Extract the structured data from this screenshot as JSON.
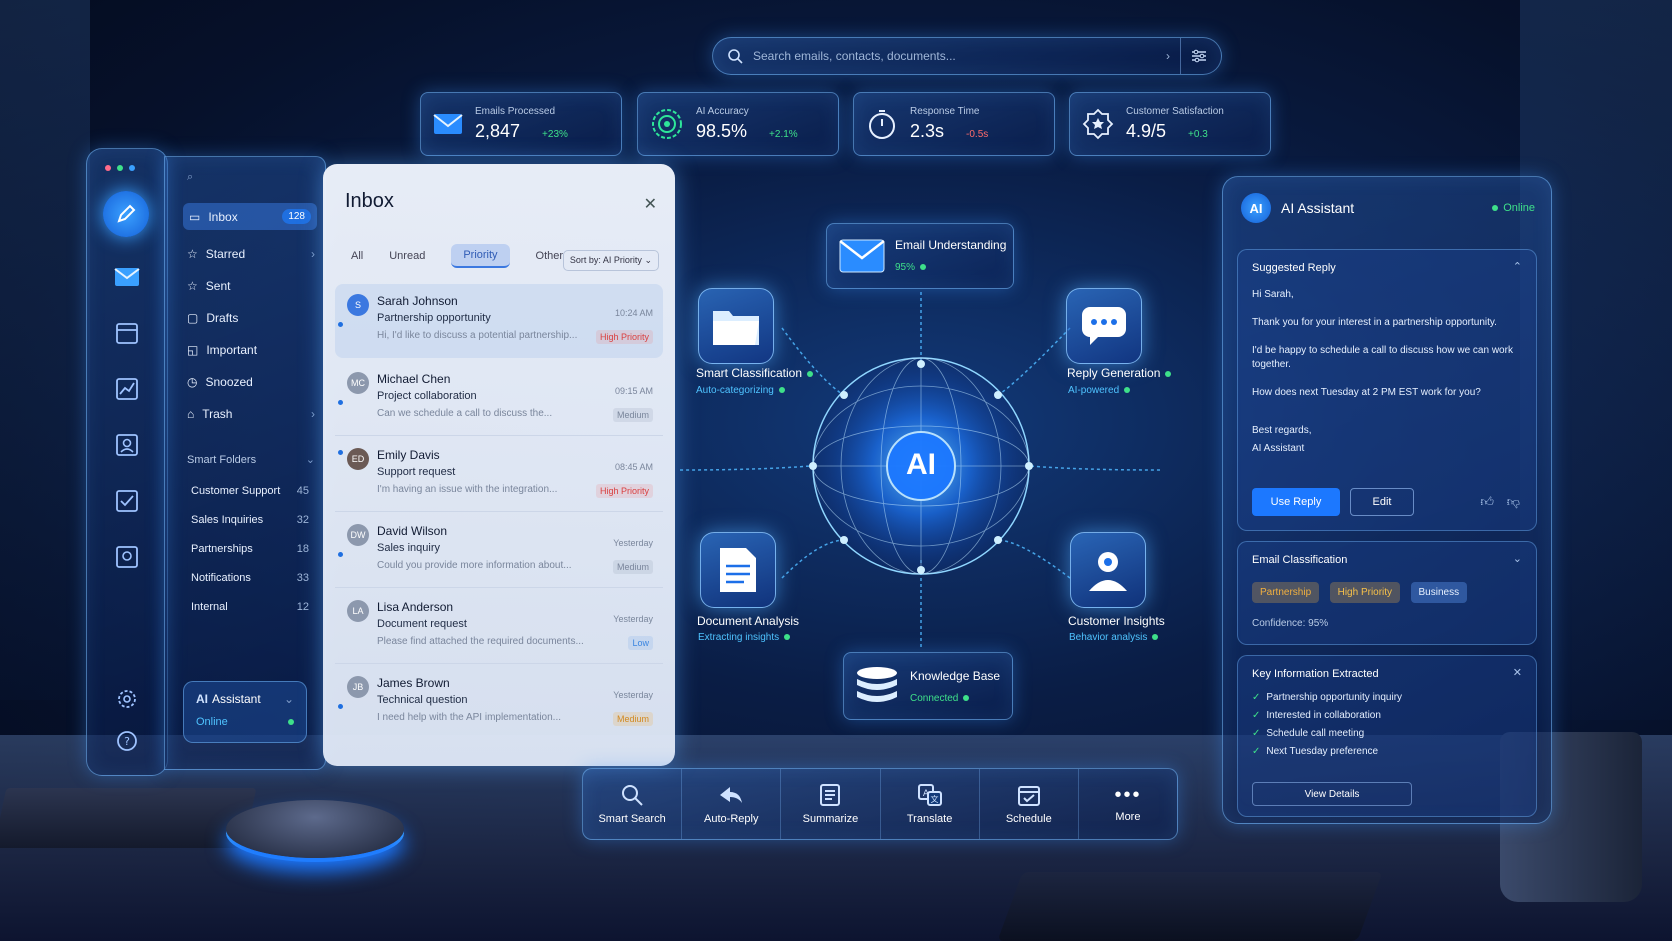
{
  "search": {
    "placeholder": "Search emails, contacts, documents..."
  },
  "stats": [
    {
      "label": "Emails Processed",
      "value": "2,847",
      "delta": "+23%",
      "icon": "envelope-icon"
    },
    {
      "label": "AI Accuracy",
      "value": "98.5%",
      "delta": "+2.1%",
      "icon": "target-icon"
    },
    {
      "label": "Response Time",
      "value": "2.3s",
      "delta": "-0.5s",
      "icon": "stopwatch-icon"
    },
    {
      "label": "Customer Satisfaction",
      "value": "4.9/5",
      "delta": "+0.3",
      "icon": "star-badge-icon"
    }
  ],
  "nav": {
    "items": [
      {
        "label": "Inbox",
        "count": "128"
      },
      {
        "label": "Starred"
      },
      {
        "label": "Sent"
      },
      {
        "label": "Drafts"
      },
      {
        "label": "Important"
      },
      {
        "label": "Snoozed"
      },
      {
        "label": "Trash"
      }
    ],
    "smart_folders_label": "Smart Folders",
    "folders": [
      {
        "label": "Customer Support",
        "count": "45"
      },
      {
        "label": "Sales Inquiries",
        "count": "32"
      },
      {
        "label": "Partnerships",
        "count": "18"
      },
      {
        "label": "Notifications",
        "count": "33"
      },
      {
        "label": "Internal",
        "count": "12"
      }
    ],
    "assistant": {
      "title": "Assistant",
      "status": "Online"
    }
  },
  "inbox": {
    "title": "Inbox",
    "tabs": [
      "All",
      "Unread",
      "Priority",
      "Other"
    ],
    "sort": "Sort by: AI Priority",
    "emails": [
      {
        "initials": "S",
        "name": "Sarah Johnson",
        "subject": "Partnership opportunity",
        "preview": "Hi, I'd like to discuss a potential partnership...",
        "time": "10:24 AM",
        "tag": "High Priority"
      },
      {
        "initials": "MC",
        "name": "Michael Chen",
        "subject": "Project collaboration",
        "preview": "Can we schedule a call to discuss the...",
        "time": "09:15 AM",
        "tag": "Medium"
      },
      {
        "initials": "ED",
        "name": "Emily Davis",
        "subject": "Support request",
        "preview": "I'm having an issue with the integration...",
        "time": "08:45 AM",
        "tag": "High Priority"
      },
      {
        "initials": "DW",
        "name": "David Wilson",
        "subject": "Sales inquiry",
        "preview": "Could you provide more information about...",
        "time": "Yesterday",
        "tag": "Medium"
      },
      {
        "initials": "LA",
        "name": "Lisa Anderson",
        "subject": "Document request",
        "preview": "Please find attached the required documents...",
        "time": "Yesterday",
        "tag": "Low"
      },
      {
        "initials": "JB",
        "name": "James Brown",
        "subject": "Technical question",
        "preview": "I need help with the API implementation...",
        "time": "Yesterday",
        "tag": "Medium"
      }
    ]
  },
  "hub": {
    "core": "AI",
    "nodes": [
      {
        "title": "Email Understanding",
        "sub": "95%"
      },
      {
        "title": "Smart Classification",
        "sub": "Auto-categorizing"
      },
      {
        "title": "Reply Generation",
        "sub": "AI-powered"
      },
      {
        "title": "Document Analysis",
        "sub": "Extracting insights"
      },
      {
        "title": "Customer Insights",
        "sub": "Behavior analysis"
      },
      {
        "title": "Knowledge Base",
        "sub": "Connected"
      }
    ]
  },
  "assistant": {
    "logo": "AI",
    "title": "AI Assistant",
    "status": "Online",
    "suggested_title": "Suggested Reply",
    "reply_lines": [
      "Hi Sarah,",
      "Thank you for your interest in a partnership opportunity.",
      "I'd be happy to schedule a call to discuss how we can work together.",
      "How does next Tuesday at 2 PM EST work for you?",
      "Best regards,",
      "AI Assistant"
    ],
    "use_reply": "Use Reply",
    "edit": "Edit",
    "classification_title": "Email Classification",
    "chips": [
      "Partnership",
      "High Priority",
      "Business"
    ],
    "confidence": "Confidence: 95%",
    "key_title": "Key Information Extracted",
    "key_items": [
      "Partnership opportunity inquiry",
      "Interested in collaboration",
      "Schedule call meeting",
      "Next Tuesday preference"
    ],
    "view_details": "View Details"
  },
  "toolbar": [
    {
      "label": "Smart Search",
      "icon": "search-icon"
    },
    {
      "label": "Auto-Reply",
      "icon": "auto-reply-icon"
    },
    {
      "label": "Summarize",
      "icon": "summarize-icon"
    },
    {
      "label": "Translate",
      "icon": "translate-icon"
    },
    {
      "label": "Schedule",
      "icon": "calendar-icon"
    },
    {
      "label": "More",
      "icon": "more-icon"
    }
  ],
  "colors": {
    "accent": "#1c78ff",
    "glow": "#3aa0ff",
    "success": "#3ee08a",
    "danger": "#ff6b6b",
    "warning": "#f0b040"
  }
}
